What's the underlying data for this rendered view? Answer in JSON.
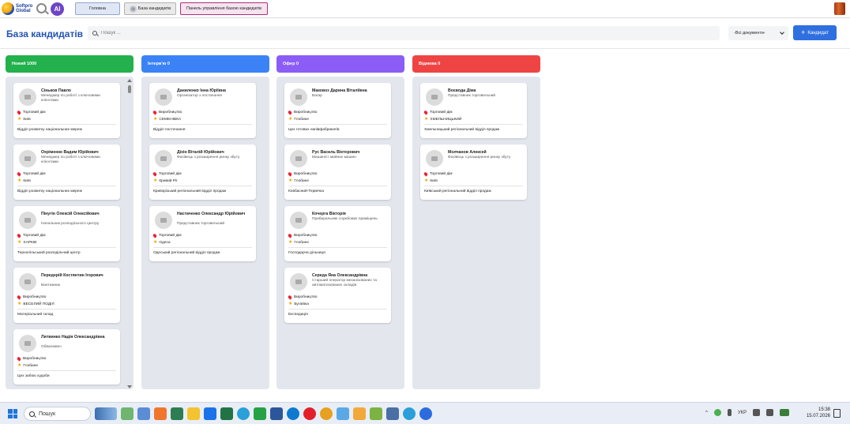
{
  "topbar": {
    "logo_line1": "Softpro",
    "logo_line2": "Global",
    "ai_label": "AI",
    "nav_home": "Головна",
    "nav_db": "База кандидатів",
    "nav_panel": "Панель управління базою кандидатів"
  },
  "header": {
    "title": "База кандидатів",
    "search_placeholder": "Пошук ...",
    "doc_filter": "-Всі документи-",
    "add_button": "Кандидат"
  },
  "columns": [
    {
      "title": "Новий 1000",
      "color": "#22b14c",
      "cards": [
        {
          "name": "Сіньков Павло",
          "role": "Менеджер по роботі з ключовими клієнтами",
          "company": "Торговий дім",
          "city": "Київ",
          "dept": "Відділ розвитку національних мереж"
        },
        {
          "name": "Охріменко Вадим Юрійович",
          "role": "Менеджер по роботі з ключовими клієнтами",
          "company": "Торговий дім",
          "city": "Київ",
          "dept": "Відділ розвитку національних мереж"
        },
        {
          "name": "Пінугін Олексій Олексійович",
          "role": "Начальник розподільного центру",
          "company": "Торговий дім",
          "city": "ХАРКІВ",
          "dept": "Тернопільський розподільчий центр"
        },
        {
          "name": "Передерій Костянтин Ігорович",
          "role": "Вантажник",
          "company": "Виробництво",
          "city": "ВЕСЕЛИЙ ПОДІЛ",
          "dept": "Матеріальний склад"
        },
        {
          "name": "Литвинко Надія Олександрівна",
          "role": "Обвалювач",
          "company": "Виробництво",
          "city": "Глобине",
          "dept": "Цех забою худоби"
        }
      ]
    },
    {
      "title": "Інтерв'ю 0",
      "color": "#3b82f6",
      "cards": [
        {
          "name": "Даниленко Інна Юріївна",
          "role": "Організатор з постачання",
          "company": "Виробництво",
          "city": "СЕМЕНІВКА",
          "dept": "Відділ постачання"
        },
        {
          "name": "Діхін Віталій Юрійович",
          "role": "Фахівець з розширення ринку збуту",
          "company": "Торговий дім",
          "city": "Кривий Ріг",
          "dept": "Криворізький регіональний відділ продаж"
        },
        {
          "name": "Настаченко Олександр Юрійович",
          "role": "Представник торговельний",
          "company": "Торговий дім",
          "city": "Одеса",
          "dept": "Одеський регіональний відділ продаж"
        }
      ]
    },
    {
      "title": "Офер 0",
      "color": "#8b5cf6",
      "cards": [
        {
          "name": "Маковоз Дарина Віталіївна",
          "role": "Вагар",
          "company": "Виробництво",
          "city": "Глобине",
          "dept": "Цех готових напівфабрикатів"
        },
        {
          "name": "Рус Василь Вікторович",
          "role": "Машиніст мийних машин",
          "company": "Виробництво",
          "city": "Глобине",
          "dept": "Ковбасний-Термічка"
        },
        {
          "name": "Кочерга Вікторія",
          "role": "Прибиральник службових приміщень",
          "company": "Виробництво",
          "city": "Глобине",
          "dept": "Господарча дільниця"
        },
        {
          "name": "Середа Яна Олександрівна",
          "role": "Старший оператор механізованих та автоматизованих складів",
          "company": "Виробництво",
          "city": "Бугаївка",
          "dept": "Експедиція"
        }
      ]
    },
    {
      "title": "Відмова 0",
      "color": "#ef4444",
      "cards": [
        {
          "name": "Воєвода Діма",
          "role": "Представник торговельний",
          "company": "Торговий дім",
          "city": "ХМЕЛЬНИЦЬКИЙ",
          "dept": "Хмельницький регіональний відділ продаж"
        },
        {
          "name": "Молчанов Алексей",
          "role": "Фахівець з розширення ринку збуту",
          "company": "Торговий дім",
          "city": "Київ",
          "dept": "Київський регіональний відділ продаж"
        }
      ]
    }
  ],
  "taskbar": {
    "search_label": "Пошук",
    "lang": "УКР",
    "time": "15:38",
    "date": "15.07.2026"
  }
}
